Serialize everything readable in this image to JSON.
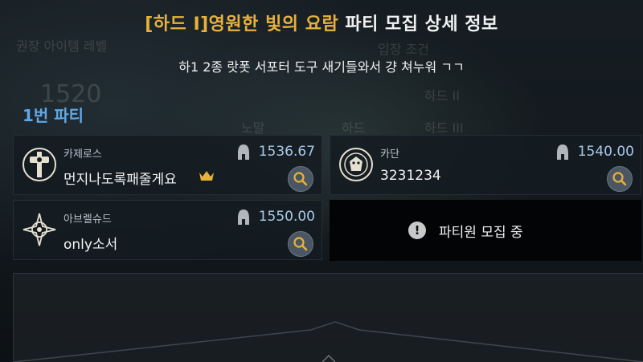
{
  "header": {
    "raid_name": "[하드 I]영원한 빛의 요람",
    "title_suffix": " 파티 모집 상세 정보",
    "description": "하1 2종 랏폿 서포터 도구 새기들와서 걍 쳐누워 ㄱㄱ"
  },
  "party": {
    "label": "1번 파티",
    "members": [
      {
        "class": "카제로스",
        "name": "먼지나도록패줄게요",
        "item_level": "1536.67",
        "leader": true,
        "icon": "paladin-class-icon"
      },
      {
        "class": "카단",
        "name": "3231234",
        "item_level": "1540.00",
        "leader": false,
        "icon": "slayer-class-icon"
      },
      {
        "class": "아브렐슈드",
        "name": "only소서",
        "item_level": "1550.00",
        "leader": false,
        "icon": "sorceress-class-icon"
      }
    ],
    "recruiting_text": "파티원 모집 중"
  },
  "background_text": {
    "left_label": "권장 아이템 레벨",
    "left_value": "1520",
    "tab_normal": "노말",
    "tab_hard": "하드",
    "right_top": "입장 조건",
    "right_a": "하드 II",
    "right_b": "하드 III"
  },
  "colors": {
    "raid_title": "#e8b23a",
    "party_label": "#5fa9e6",
    "item_level": "#a9c9e6"
  }
}
